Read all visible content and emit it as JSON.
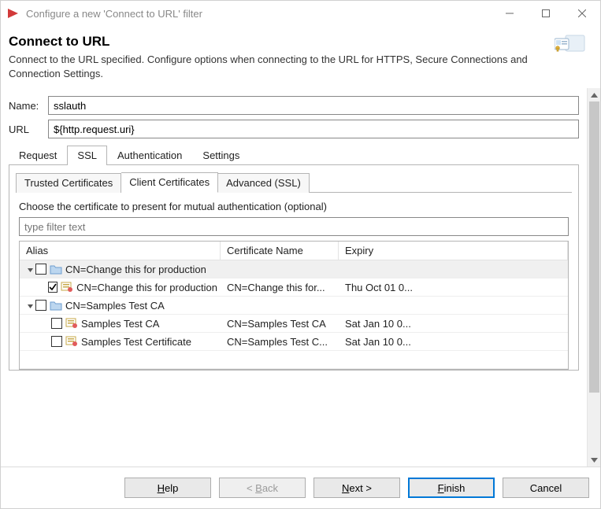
{
  "window": {
    "title": "Configure a new 'Connect to URL' filter"
  },
  "header": {
    "title": "Connect to URL",
    "description": "Connect to the URL specified.  Configure options when connecting to the URL for HTTPS, Secure Connections and Connection Settings."
  },
  "form": {
    "name_label": "Name:",
    "name_value": "sslauth",
    "url_label": "URL",
    "url_value": "${http.request.uri}"
  },
  "tabs": {
    "items": [
      {
        "label": "Request",
        "active": false
      },
      {
        "label": "SSL",
        "active": true
      },
      {
        "label": "Authentication",
        "active": false
      },
      {
        "label": "Settings",
        "active": false
      }
    ]
  },
  "inner_tabs": {
    "items": [
      {
        "label": "Trusted Certificates",
        "active": false
      },
      {
        "label": "Client Certificates",
        "active": true
      },
      {
        "label": "Advanced (SSL)",
        "active": false
      }
    ]
  },
  "client_certs": {
    "hint": "Choose the certificate to present for mutual authentication (optional)",
    "filter_placeholder": "type filter text",
    "columns": {
      "alias": "Alias",
      "name": "Certificate Name",
      "expiry": "Expiry"
    },
    "rows": [
      {
        "kind": "group",
        "expanded": true,
        "checked": false,
        "alias": "CN=Change this for production",
        "indent": 0,
        "selected": true
      },
      {
        "kind": "cert",
        "checked": true,
        "alias": "CN=Change this for production",
        "name": "CN=Change this for...",
        "expiry": "Thu Oct 01 0...",
        "indent": 1
      },
      {
        "kind": "group",
        "expanded": true,
        "checked": false,
        "alias": "CN=Samples Test CA",
        "indent": 0
      },
      {
        "kind": "cert",
        "checked": false,
        "alias": "Samples Test CA",
        "name": "CN=Samples Test CA",
        "expiry": "Sat Jan 10 0...",
        "indent": 1
      },
      {
        "kind": "cert",
        "checked": false,
        "alias": "Samples Test Certificate",
        "name": "CN=Samples Test C...",
        "expiry": "Sat Jan 10 0...",
        "indent": 1
      }
    ]
  },
  "buttons": {
    "help": "Help",
    "back": "< Back",
    "next": "Next >",
    "finish": "Finish",
    "cancel": "Cancel"
  }
}
